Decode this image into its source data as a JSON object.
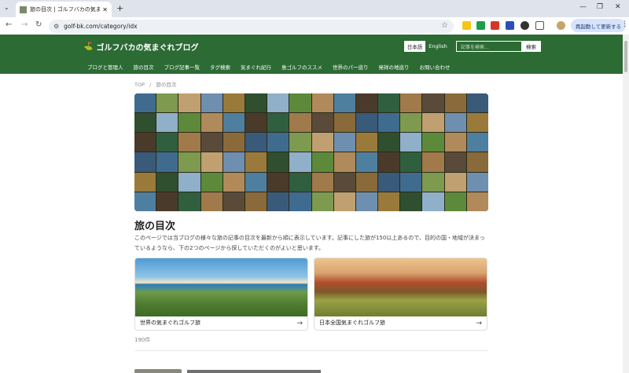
{
  "browser": {
    "tab_title": "旅の目次 | ゴルフバカの気まぐれブログ",
    "tab_close": "✕",
    "new_tab": "+",
    "tab_menu": "⌄",
    "url": "golf-bk.com/category/idx",
    "relaunch_label": "再起動して更新する",
    "window_controls": [
      "—",
      "❐",
      "✕"
    ],
    "kebab": "⋮"
  },
  "site": {
    "logo_text": "ゴルフバカの気まぐれブログ",
    "lang_ja": "日本語",
    "lang_en": "English",
    "search_placeholder": "記事を検索...",
    "search_button": "検索",
    "menu": [
      "ブログと管理人",
      "旅の目次",
      "ブログ記事一覧",
      "タグ検索",
      "気まぐれ紀行",
      "島ゴルフのススメ",
      "世界のパー巡り",
      "発祥の地巡り",
      "お問い合わせ"
    ]
  },
  "breadcrumb": {
    "home": "TOP",
    "sep": "/",
    "current": "旅の目次"
  },
  "main": {
    "title": "旅の目次",
    "intro": "このページでは当ブログの様々な旅の記事の目次を最新から順に表示しています。記事にした旅が150以上あるので、目的の国・地域が決まっているようなら、下の2つのページから探していただくのがよいと思います。",
    "cards": [
      {
        "label": "世界の気まぐれゴルフ旅",
        "arrow": "→"
      },
      {
        "label": "日本全国気まぐれゴルフ旅",
        "arrow": "→"
      }
    ],
    "count": "190件"
  },
  "colors": {
    "header_green": "#2c6b34",
    "accent": "#1d3a72"
  }
}
